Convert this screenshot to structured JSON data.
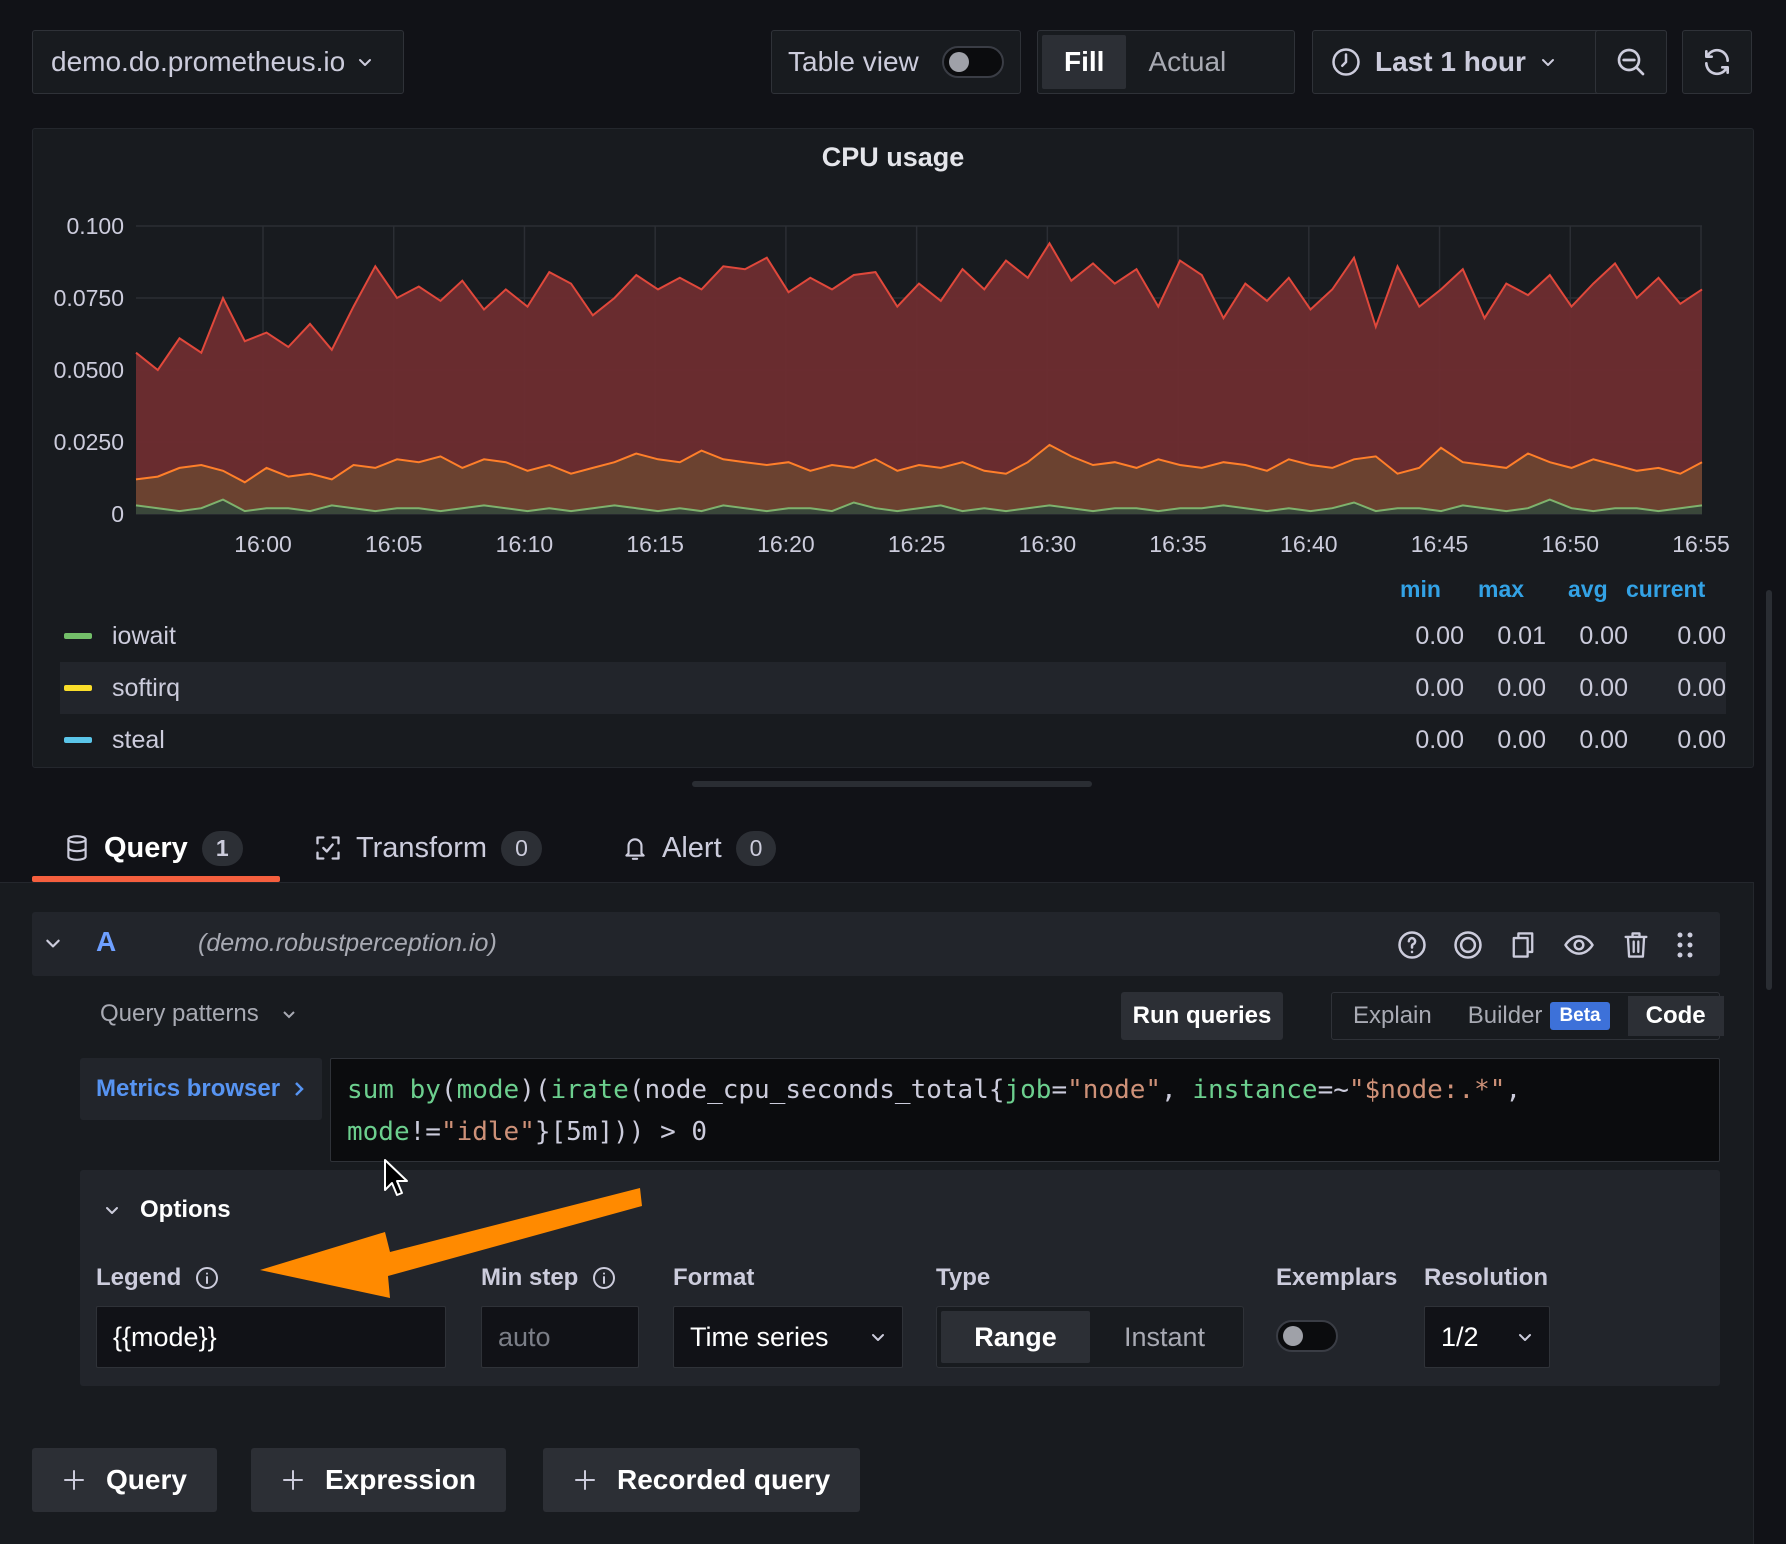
{
  "toolbar": {
    "datasource": "demo.do.prometheus.io",
    "table_view_label": "Table view",
    "fill_label": "Fill",
    "actual_label": "Actual",
    "time_range": "Last 1 hour"
  },
  "panel": {
    "title": "CPU usage"
  },
  "chart_data": {
    "type": "area",
    "title": "CPU usage",
    "x_tick_labels": [
      "16:00",
      "16:05",
      "16:10",
      "16:15",
      "16:20",
      "16:25",
      "16:30",
      "16:35",
      "16:40",
      "16:45",
      "16:50",
      "16:55"
    ],
    "y_tick_labels": [
      "0",
      "0.0250",
      "0.0500",
      "0.0750",
      "0.100"
    ],
    "ylim": [
      0,
      0.1
    ],
    "grid": true,
    "series": [
      {
        "color": "#e0483b",
        "fill": "#6e2d30",
        "values": [
          0.056,
          0.05,
          0.061,
          0.056,
          0.075,
          0.06,
          0.063,
          0.058,
          0.066,
          0.057,
          0.072,
          0.086,
          0.075,
          0.079,
          0.074,
          0.081,
          0.071,
          0.078,
          0.072,
          0.084,
          0.08,
          0.069,
          0.075,
          0.083,
          0.078,
          0.082,
          0.078,
          0.086,
          0.085,
          0.089,
          0.077,
          0.082,
          0.078,
          0.083,
          0.084,
          0.072,
          0.08,
          0.074,
          0.085,
          0.078,
          0.088,
          0.082,
          0.094,
          0.081,
          0.087,
          0.08,
          0.085,
          0.072,
          0.088,
          0.083,
          0.068,
          0.08,
          0.074,
          0.082,
          0.071,
          0.078,
          0.089,
          0.065,
          0.086,
          0.072,
          0.078,
          0.085,
          0.068,
          0.08,
          0.076,
          0.083,
          0.072,
          0.08,
          0.087,
          0.075,
          0.082,
          0.073,
          0.078
        ]
      },
      {
        "color": "#ff7f2a",
        "fill": "#6b4330",
        "values": [
          0.012,
          0.013,
          0.016,
          0.017,
          0.015,
          0.011,
          0.016,
          0.013,
          0.014,
          0.012,
          0.017,
          0.016,
          0.019,
          0.018,
          0.02,
          0.016,
          0.019,
          0.018,
          0.015,
          0.017,
          0.014,
          0.016,
          0.018,
          0.021,
          0.019,
          0.018,
          0.022,
          0.019,
          0.018,
          0.017,
          0.018,
          0.015,
          0.017,
          0.016,
          0.019,
          0.015,
          0.017,
          0.016,
          0.018,
          0.015,
          0.014,
          0.018,
          0.024,
          0.02,
          0.017,
          0.018,
          0.016,
          0.019,
          0.017,
          0.016,
          0.018,
          0.017,
          0.015,
          0.019,
          0.017,
          0.016,
          0.019,
          0.02,
          0.014,
          0.016,
          0.023,
          0.018,
          0.017,
          0.016,
          0.021,
          0.018,
          0.016,
          0.019,
          0.017,
          0.015,
          0.016,
          0.014,
          0.018
        ]
      },
      {
        "color": "#7eb26d",
        "fill": "#38483b",
        "values": [
          0.003,
          0.002,
          0.001,
          0.002,
          0.005,
          0.001,
          0.002,
          0.002,
          0.001,
          0.003,
          0.002,
          0.001,
          0.002,
          0.002,
          0.001,
          0.002,
          0.003,
          0.002,
          0.001,
          0.002,
          0.001,
          0.002,
          0.003,
          0.002,
          0.001,
          0.002,
          0.001,
          0.003,
          0.002,
          0.001,
          0.002,
          0.002,
          0.001,
          0.004,
          0.002,
          0.001,
          0.002,
          0.003,
          0.001,
          0.002,
          0.001,
          0.002,
          0.003,
          0.002,
          0.001,
          0.002,
          0.002,
          0.001,
          0.002,
          0.002,
          0.003,
          0.002,
          0.001,
          0.002,
          0.001,
          0.002,
          0.004,
          0.001,
          0.002,
          0.002,
          0.001,
          0.003,
          0.002,
          0.001,
          0.002,
          0.005,
          0.002,
          0.001,
          0.002,
          0.002,
          0.001,
          0.002,
          0.003
        ]
      }
    ]
  },
  "legend": {
    "headers": {
      "min": "min",
      "max": "max",
      "avg": "avg",
      "current": "current"
    },
    "rows": [
      {
        "name": "iowait",
        "color": "#73bf69",
        "min": "0.00",
        "max": "0.01",
        "avg": "0.00",
        "current": "0.00"
      },
      {
        "name": "softirq",
        "color": "#fade2a",
        "min": "0.00",
        "max": "0.00",
        "avg": "0.00",
        "current": "0.00"
      },
      {
        "name": "steal",
        "color": "#5ac5e8",
        "min": "0.00",
        "max": "0.00",
        "avg": "0.00",
        "current": "0.00"
      }
    ]
  },
  "tabs": [
    {
      "label": "Query",
      "count": "1"
    },
    {
      "label": "Transform",
      "count": "0"
    },
    {
      "label": "Alert",
      "count": "0"
    }
  ],
  "query": {
    "ref_id": "A",
    "datasource": "(demo.robustperception.io)",
    "patterns_label": "Query patterns",
    "run_label": "Run queries",
    "modes": {
      "explain": "Explain",
      "builder": "Builder",
      "beta": "Beta",
      "code": "Code"
    },
    "metrics_browser": "Metrics browser",
    "code": {
      "sum": "sum",
      "by": "by",
      "mode1": "mode",
      "irate": "irate",
      "metric": "node_cpu_seconds_total",
      "job_lbl": "job",
      "job_val": "\"node\"",
      "inst_lbl": "instance",
      "inst_val": "\"$node:.*\"",
      "mode_lbl": "mode",
      "mode_val": "\"idle\"",
      "range": "[5m]",
      "gt": "> 0"
    }
  },
  "options": {
    "title": "Options",
    "legend_label": "Legend",
    "legend_value": "{{mode}}",
    "minstep_label": "Min step",
    "minstep_placeholder": "auto",
    "format_label": "Format",
    "format_value": "Time series",
    "type_label": "Type",
    "type_range": "Range",
    "type_instant": "Instant",
    "exemplars_label": "Exemplars",
    "resolution_label": "Resolution",
    "resolution_value": "1/2"
  },
  "add_buttons": {
    "query": "Query",
    "expression": "Expression",
    "recorded": "Recorded query"
  },
  "colors": {
    "accent": "#f55f3e",
    "arrow": "#ff8a00",
    "link": "#5794f2"
  }
}
